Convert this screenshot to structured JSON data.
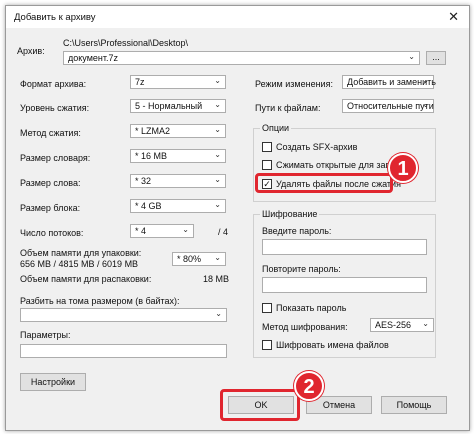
{
  "window": {
    "title": "Добавить к архиву",
    "close_glyph": "✕"
  },
  "archive": {
    "label": "Архив:",
    "path": "C:\\Users\\Professional\\Desktop\\",
    "filename": "документ.7z",
    "browse_label": "..."
  },
  "left": {
    "format": {
      "label": "Формат архива:",
      "value": "7z"
    },
    "level": {
      "label": "Уровень сжатия:",
      "value": "5 - Нормальный"
    },
    "method": {
      "label": "Метод сжатия:",
      "value": "* LZMA2"
    },
    "dict": {
      "label": "Размер словаря:",
      "value": "* 16 MB"
    },
    "word": {
      "label": "Размер слова:",
      "value": "* 32"
    },
    "block": {
      "label": "Размер блока:",
      "value": "* 4 GB"
    },
    "threads": {
      "label": "Число потоков:",
      "value": "* 4",
      "max": "/ 4"
    },
    "mem_pack_label": "Объем памяти для упаковки:",
    "mem_pack_value": "656 MB / 4815 MB / 6019 MB",
    "mem_pct": "* 80%",
    "mem_unpack_label": "Объем памяти для распаковки:",
    "mem_unpack_value": "18 MB",
    "split_label": "Разбить на тома размером (в байтах):",
    "params_label": "Параметры:",
    "settings_button": "Настройки"
  },
  "right": {
    "mode": {
      "label": "Режим изменения:",
      "value": "Добавить и заменить"
    },
    "paths": {
      "label": "Пути к файлам:",
      "value": "Относительные пути"
    },
    "options": {
      "title": "Опции",
      "items": [
        {
          "label": "Создать SFX-архив",
          "checked": false
        },
        {
          "label": "Сжимать открытые для записи",
          "checked": false
        },
        {
          "label": "Удалять файлы после сжатия",
          "checked": true
        }
      ]
    },
    "encryption": {
      "title": "Шифрование",
      "password_label": "Введите пароль:",
      "repeat_label": "Повторите пароль:",
      "show_password": "Показать пароль",
      "method_label": "Метод шифрования:",
      "method_value": "AES-256",
      "encrypt_names": "Шифровать имена файлов"
    }
  },
  "footer": {
    "ok": "OK",
    "cancel": "Отмена",
    "help": "Помощь"
  },
  "annotations": {
    "step1": "1",
    "step2": "2",
    "highlight_color": "#e0262f"
  },
  "glyphs": {
    "dropdown_arrow": "⌄",
    "check": "✓"
  }
}
